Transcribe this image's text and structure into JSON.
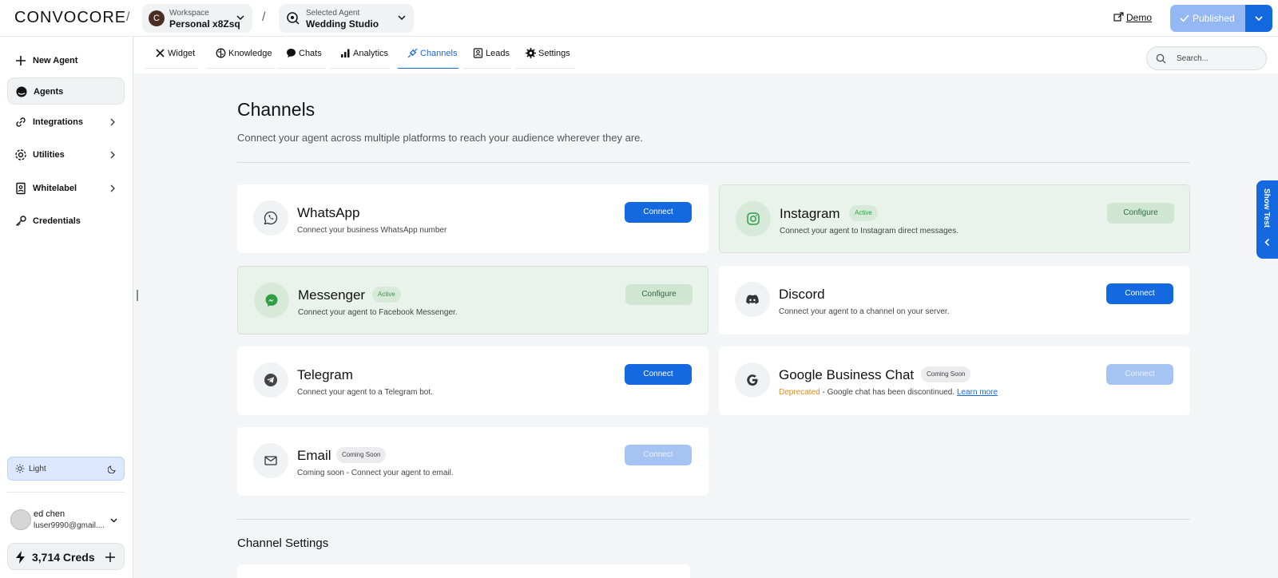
{
  "header": {
    "logo": "CONVOCORE",
    "separator": "/",
    "workspace": {
      "avatar_letter": "C",
      "label": "Workspace",
      "value": "Personal x8Zsq"
    },
    "agent": {
      "label": "Selected Agent",
      "value": "Wedding Studio"
    },
    "demo": "Demo",
    "published": "Published"
  },
  "sidebar": {
    "items": [
      {
        "label": "New Agent",
        "icon": "plus-icon"
      },
      {
        "label": "Agents",
        "icon": "agent-icon"
      },
      {
        "label": "Integrations",
        "icon": "link-icon"
      },
      {
        "label": "Utilities",
        "icon": "gear-icon"
      },
      {
        "label": "Whitelabel",
        "icon": "badge-icon"
      },
      {
        "label": "Credentials",
        "icon": "key-icon"
      }
    ],
    "theme": "Light",
    "user": {
      "name": "ed chen",
      "email": "luser9990@gmail...."
    },
    "creds": "3,714 Creds"
  },
  "tabs": [
    {
      "label": "Widget"
    },
    {
      "label": "Knowledge"
    },
    {
      "label": "Chats"
    },
    {
      "label": "Analytics"
    },
    {
      "label": "Channels"
    },
    {
      "label": "Leads"
    },
    {
      "label": "Settings"
    }
  ],
  "search": {
    "placeholder": "Search..."
  },
  "page": {
    "title": "Channels",
    "subtitle": "Connect your agent across multiple platforms to reach your audience wherever they are."
  },
  "channels": [
    {
      "name": "WhatsApp",
      "desc": "Connect your business WhatsApp number",
      "badge": "",
      "button": "Connect"
    },
    {
      "name": "Instagram",
      "desc": "Connect your agent to Instagram direct messages.",
      "badge": "Active",
      "button": "Configure"
    },
    {
      "name": "Messenger",
      "desc": "Connect your agent to Facebook Messenger.",
      "badge": "Active",
      "button": "Configure"
    },
    {
      "name": "Discord",
      "desc": "Connect your agent to a channel on your server.",
      "badge": "",
      "button": "Connect"
    },
    {
      "name": "Telegram",
      "desc": "Connect your agent to a Telegram bot.",
      "badge": "",
      "button": "Connect"
    },
    {
      "name": "Google Business Chat",
      "desc_prefix": "Deprecated",
      "desc": " - Google chat has been discontinued. ",
      "desc_link": "Learn more",
      "badge": "Coming Soon",
      "button": "Connect"
    },
    {
      "name": "Email",
      "desc": "Coming soon - Connect your agent to email.",
      "badge": "Coming Soon",
      "button": "Connect"
    }
  ],
  "channel_settings": {
    "title": "Channel Settings"
  },
  "show_test": "Show Test",
  "colors": {
    "primary": "#1468e0",
    "active_green": "#2e9e47",
    "deprecated": "#e28b1f"
  }
}
